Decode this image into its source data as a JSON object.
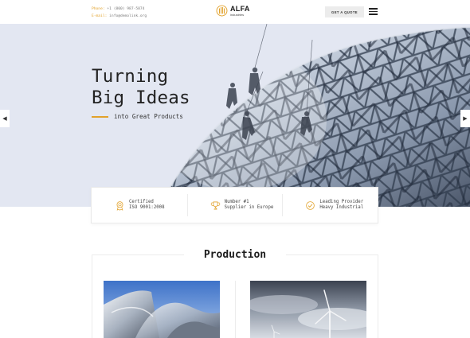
{
  "header": {
    "phone_label": "Phone:",
    "phone_value": "+1 (800) 987-5874",
    "email_label": "E-mail:",
    "email_value": "info@demolink.org",
    "logo_name": "ALFA",
    "logo_sub": "industries",
    "quote_label": "GET A QUOTE"
  },
  "hero": {
    "title_line1": "Turning",
    "title_line2": "Big Ideas",
    "subtitle": "into Great Products",
    "prev_glyph": "◀",
    "next_glyph": "▶"
  },
  "features": [
    {
      "line1": "Certified",
      "line2": "ISO 9001:2008",
      "icon": "award-ribbon-icon"
    },
    {
      "line1": "Number #1",
      "line2": "Supplier in Europe",
      "icon": "trophy-icon"
    },
    {
      "line1": "Leading Provider",
      "line2": "Heavy Industrial",
      "icon": "check-circle-icon"
    }
  ],
  "production": {
    "title": "Production"
  },
  "colors": {
    "accent": "#e2a22b",
    "hero_bg": "#e3e7f2",
    "text_dark": "#1e1e1e"
  }
}
